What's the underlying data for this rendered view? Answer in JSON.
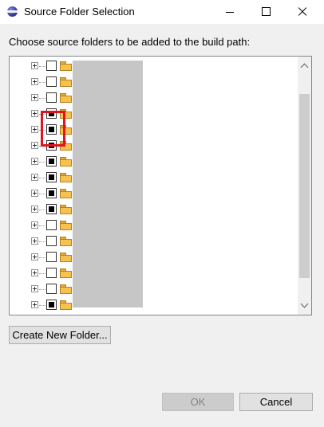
{
  "window": {
    "title": "Source Folder Selection"
  },
  "prompt": "Choose source folders to be added to the build path:",
  "tree": {
    "rows": [
      {
        "checked": false
      },
      {
        "checked": false
      },
      {
        "checked": false
      },
      {
        "checked": true
      },
      {
        "checked": true
      },
      {
        "checked": true
      },
      {
        "checked": true
      },
      {
        "checked": true
      },
      {
        "checked": true
      },
      {
        "checked": true
      },
      {
        "checked": false
      },
      {
        "checked": false
      },
      {
        "checked": false
      },
      {
        "checked": false
      },
      {
        "checked": false
      },
      {
        "checked": true
      }
    ]
  },
  "buttons": {
    "create_new_folder": "Create New Folder...",
    "ok": "OK",
    "cancel": "Cancel"
  },
  "icons": {
    "app": "eclipse-icon",
    "expand": "plus-box-icon",
    "folder": "folder-open-icon"
  },
  "colors": {
    "highlight_box": "#e0141e",
    "redacted_names": "#c6c6c6",
    "folder": "#f6c24f"
  }
}
